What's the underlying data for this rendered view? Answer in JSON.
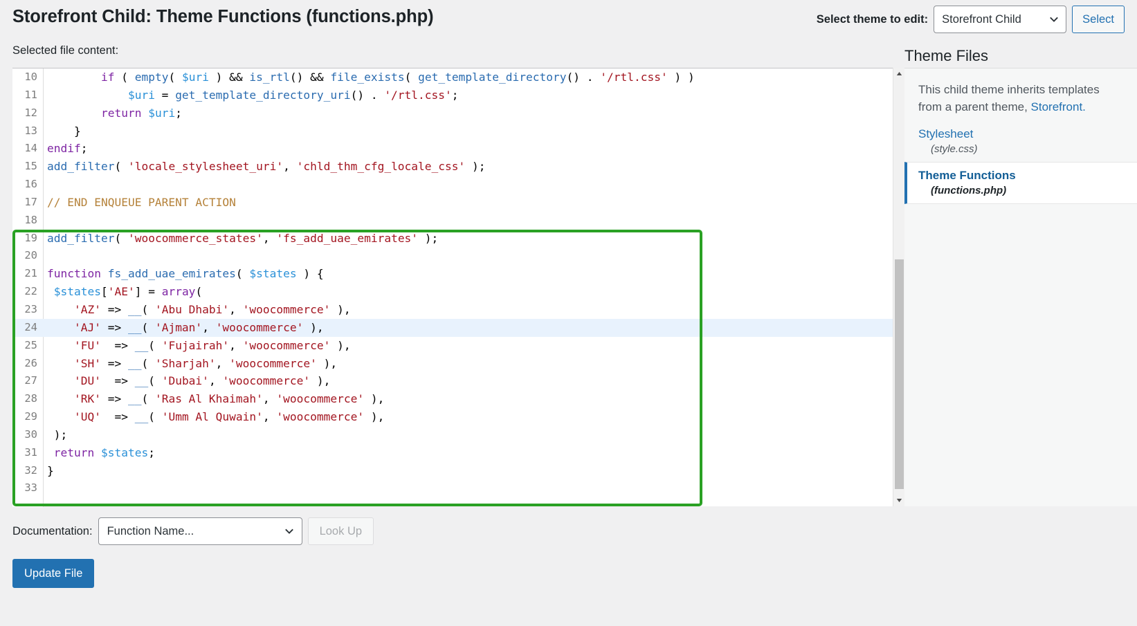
{
  "header": {
    "page_title": "Storefront Child: Theme Functions (functions.php)",
    "theme_switcher_label": "Select theme to edit:",
    "theme_selected": "Storefront Child",
    "select_button": "Select",
    "chevron_icon": "chevron-down-icon"
  },
  "editor": {
    "file_content_label": "Selected file content:",
    "highlighted_line": 24,
    "annotation_color": "#2aa124",
    "lines": [
      {
        "n": 10,
        "tokens": [
          {
            "t": "pl",
            "s": "        "
          },
          {
            "t": "kw",
            "s": "if"
          },
          {
            "t": "pl",
            "s": " ( "
          },
          {
            "t": "fn",
            "s": "empty"
          },
          {
            "t": "pl",
            "s": "( "
          },
          {
            "t": "var",
            "s": "$uri"
          },
          {
            "t": "pl",
            "s": " ) && "
          },
          {
            "t": "fn",
            "s": "is_rtl"
          },
          {
            "t": "pl",
            "s": "() && "
          },
          {
            "t": "fn",
            "s": "file_exists"
          },
          {
            "t": "pl",
            "s": "( "
          },
          {
            "t": "fn",
            "s": "get_template_directory"
          },
          {
            "t": "pl",
            "s": "() . "
          },
          {
            "t": "str",
            "s": "'/rtl.css'"
          },
          {
            "t": "pl",
            "s": " ) )"
          }
        ]
      },
      {
        "n": 11,
        "tokens": [
          {
            "t": "pl",
            "s": "            "
          },
          {
            "t": "var",
            "s": "$uri"
          },
          {
            "t": "pl",
            "s": " = "
          },
          {
            "t": "fn",
            "s": "get_template_directory_uri"
          },
          {
            "t": "pl",
            "s": "() . "
          },
          {
            "t": "str",
            "s": "'/rtl.css'"
          },
          {
            "t": "pl",
            "s": ";"
          }
        ]
      },
      {
        "n": 12,
        "tokens": [
          {
            "t": "pl",
            "s": "        "
          },
          {
            "t": "kw",
            "s": "return"
          },
          {
            "t": "pl",
            "s": " "
          },
          {
            "t": "var",
            "s": "$uri"
          },
          {
            "t": "pl",
            "s": ";"
          }
        ]
      },
      {
        "n": 13,
        "tokens": [
          {
            "t": "pl",
            "s": "    }"
          }
        ]
      },
      {
        "n": 14,
        "tokens": [
          {
            "t": "kw",
            "s": "endif"
          },
          {
            "t": "pl",
            "s": ";"
          }
        ]
      },
      {
        "n": 15,
        "tokens": [
          {
            "t": "fn",
            "s": "add_filter"
          },
          {
            "t": "pl",
            "s": "( "
          },
          {
            "t": "str",
            "s": "'locale_stylesheet_uri'"
          },
          {
            "t": "pl",
            "s": ", "
          },
          {
            "t": "str",
            "s": "'chld_thm_cfg_locale_css'"
          },
          {
            "t": "pl",
            "s": " );"
          }
        ]
      },
      {
        "n": 16,
        "tokens": [
          {
            "t": "pl",
            "s": ""
          }
        ]
      },
      {
        "n": 17,
        "tokens": [
          {
            "t": "com",
            "s": "// END ENQUEUE PARENT ACTION"
          }
        ]
      },
      {
        "n": 18,
        "tokens": [
          {
            "t": "pl",
            "s": ""
          }
        ]
      },
      {
        "n": 19,
        "tokens": [
          {
            "t": "fn",
            "s": "add_filter"
          },
          {
            "t": "pl",
            "s": "( "
          },
          {
            "t": "str",
            "s": "'woocommerce_states'"
          },
          {
            "t": "pl",
            "s": ", "
          },
          {
            "t": "str",
            "s": "'fs_add_uae_emirates'"
          },
          {
            "t": "pl",
            "s": " );"
          }
        ]
      },
      {
        "n": 20,
        "tokens": [
          {
            "t": "pl",
            "s": ""
          }
        ]
      },
      {
        "n": 21,
        "tokens": [
          {
            "t": "kw",
            "s": "function"
          },
          {
            "t": "pl",
            "s": " "
          },
          {
            "t": "fn",
            "s": "fs_add_uae_emirates"
          },
          {
            "t": "pl",
            "s": "( "
          },
          {
            "t": "var",
            "s": "$states"
          },
          {
            "t": "pl",
            "s": " ) {"
          }
        ]
      },
      {
        "n": 22,
        "tokens": [
          {
            "t": "pl",
            "s": " "
          },
          {
            "t": "var",
            "s": "$states"
          },
          {
            "t": "pl",
            "s": "["
          },
          {
            "t": "str",
            "s": "'AE'"
          },
          {
            "t": "pl",
            "s": "] = "
          },
          {
            "t": "kw",
            "s": "array"
          },
          {
            "t": "pl",
            "s": "("
          }
        ]
      },
      {
        "n": 23,
        "tokens": [
          {
            "t": "pl",
            "s": "    "
          },
          {
            "t": "str",
            "s": "'AZ'"
          },
          {
            "t": "pl",
            "s": " => "
          },
          {
            "t": "fn",
            "s": "__"
          },
          {
            "t": "pl",
            "s": "( "
          },
          {
            "t": "str",
            "s": "'Abu Dhabi'"
          },
          {
            "t": "pl",
            "s": ", "
          },
          {
            "t": "str",
            "s": "'woocommerce'"
          },
          {
            "t": "pl",
            "s": " ),"
          }
        ]
      },
      {
        "n": 24,
        "tokens": [
          {
            "t": "pl",
            "s": "    "
          },
          {
            "t": "str",
            "s": "'AJ'"
          },
          {
            "t": "pl",
            "s": " => "
          },
          {
            "t": "fn",
            "s": "__"
          },
          {
            "t": "pl",
            "s": "( "
          },
          {
            "t": "str",
            "s": "'Ajman'"
          },
          {
            "t": "pl",
            "s": ", "
          },
          {
            "t": "str",
            "s": "'woocommerce'"
          },
          {
            "t": "pl",
            "s": " ),"
          }
        ]
      },
      {
        "n": 25,
        "tokens": [
          {
            "t": "pl",
            "s": "    "
          },
          {
            "t": "str",
            "s": "'FU'"
          },
          {
            "t": "pl",
            "s": "  => "
          },
          {
            "t": "fn",
            "s": "__"
          },
          {
            "t": "pl",
            "s": "( "
          },
          {
            "t": "str",
            "s": "'Fujairah'"
          },
          {
            "t": "pl",
            "s": ", "
          },
          {
            "t": "str",
            "s": "'woocommerce'"
          },
          {
            "t": "pl",
            "s": " ),"
          }
        ]
      },
      {
        "n": 26,
        "tokens": [
          {
            "t": "pl",
            "s": "    "
          },
          {
            "t": "str",
            "s": "'SH'"
          },
          {
            "t": "pl",
            "s": " => "
          },
          {
            "t": "fn",
            "s": "__"
          },
          {
            "t": "pl",
            "s": "( "
          },
          {
            "t": "str",
            "s": "'Sharjah'"
          },
          {
            "t": "pl",
            "s": ", "
          },
          {
            "t": "str",
            "s": "'woocommerce'"
          },
          {
            "t": "pl",
            "s": " ),"
          }
        ]
      },
      {
        "n": 27,
        "tokens": [
          {
            "t": "pl",
            "s": "    "
          },
          {
            "t": "str",
            "s": "'DU'"
          },
          {
            "t": "pl",
            "s": "  => "
          },
          {
            "t": "fn",
            "s": "__"
          },
          {
            "t": "pl",
            "s": "( "
          },
          {
            "t": "str",
            "s": "'Dubai'"
          },
          {
            "t": "pl",
            "s": ", "
          },
          {
            "t": "str",
            "s": "'woocommerce'"
          },
          {
            "t": "pl",
            "s": " ),"
          }
        ]
      },
      {
        "n": 28,
        "tokens": [
          {
            "t": "pl",
            "s": "    "
          },
          {
            "t": "str",
            "s": "'RK'"
          },
          {
            "t": "pl",
            "s": " => "
          },
          {
            "t": "fn",
            "s": "__"
          },
          {
            "t": "pl",
            "s": "( "
          },
          {
            "t": "str",
            "s": "'Ras Al Khaimah'"
          },
          {
            "t": "pl",
            "s": ", "
          },
          {
            "t": "str",
            "s": "'woocommerce'"
          },
          {
            "t": "pl",
            "s": " ),"
          }
        ]
      },
      {
        "n": 29,
        "tokens": [
          {
            "t": "pl",
            "s": "    "
          },
          {
            "t": "str",
            "s": "'UQ'"
          },
          {
            "t": "pl",
            "s": "  => "
          },
          {
            "t": "fn",
            "s": "__"
          },
          {
            "t": "pl",
            "s": "( "
          },
          {
            "t": "str",
            "s": "'Umm Al Quwain'"
          },
          {
            "t": "pl",
            "s": ", "
          },
          {
            "t": "str",
            "s": "'woocommerce'"
          },
          {
            "t": "pl",
            "s": " ),"
          }
        ]
      },
      {
        "n": 30,
        "tokens": [
          {
            "t": "pl",
            "s": " );"
          }
        ]
      },
      {
        "n": 31,
        "tokens": [
          {
            "t": "pl",
            "s": " "
          },
          {
            "t": "kw",
            "s": "return"
          },
          {
            "t": "pl",
            "s": " "
          },
          {
            "t": "var",
            "s": "$states"
          },
          {
            "t": "pl",
            "s": ";"
          }
        ]
      },
      {
        "n": 32,
        "tokens": [
          {
            "t": "pl",
            "s": "}"
          }
        ]
      },
      {
        "n": 33,
        "tokens": [
          {
            "t": "pl",
            "s": ""
          }
        ]
      }
    ],
    "scrollbar": {
      "up_arrow_icon": "triangle-up-icon",
      "down_arrow_icon": "triangle-down-icon"
    }
  },
  "sidebar": {
    "heading": "Theme Files",
    "notice_text": "This child theme inherits templates from a parent theme, ",
    "notice_link": "Storefront.",
    "files": [
      {
        "name": "Stylesheet",
        "file": "(style.css)",
        "active": false
      },
      {
        "name": "Theme Functions",
        "file": "(functions.php)",
        "active": true
      }
    ]
  },
  "footer": {
    "documentation_label": "Documentation:",
    "documentation_selected": "Function Name...",
    "lookup_button": "Look Up",
    "update_button": "Update File",
    "chevron_icon": "chevron-down-icon"
  }
}
